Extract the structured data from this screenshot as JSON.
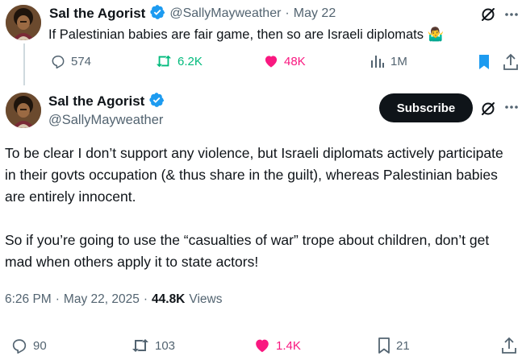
{
  "parent_tweet": {
    "author_name": "Sal the Agorist",
    "handle": "@SallyMayweather",
    "separator": "·",
    "date": "May 22",
    "text": "If Palestinian babies are fair game, then so are Israeli diplomats",
    "emoji": "🤷‍♂️",
    "stats": {
      "replies": "574",
      "reposts": "6.2K",
      "likes": "48K",
      "views": "1M"
    },
    "bookmarked": true
  },
  "main_tweet": {
    "author_name": "Sal the Agorist",
    "handle": "@SallyMayweather",
    "subscribe_label": "Subscribe",
    "paragraph1": "To be clear I don’t support any violence, but Israeli diplomats actively participate in their govts occupation (& thus share in the guilt), whereas Palestinian babies are entirely innocent.",
    "paragraph2": "So if you’re going to use the “casualties of war” trope about children, don’t get mad when others apply it to state actors!",
    "time": "6:26 PM",
    "date": "May 22, 2025",
    "dot": "·",
    "views_count": "44.8K",
    "views_label": "Views",
    "stats": {
      "replies": "90",
      "reposts": "103",
      "likes": "1.4K",
      "bookmarks": "21"
    }
  },
  "colors": {
    "verified": "#1d9bf0",
    "repost_active": "#00ba7c",
    "like_active": "#f91880",
    "bookmark_active": "#1d9bf0",
    "muted": "#536471"
  }
}
